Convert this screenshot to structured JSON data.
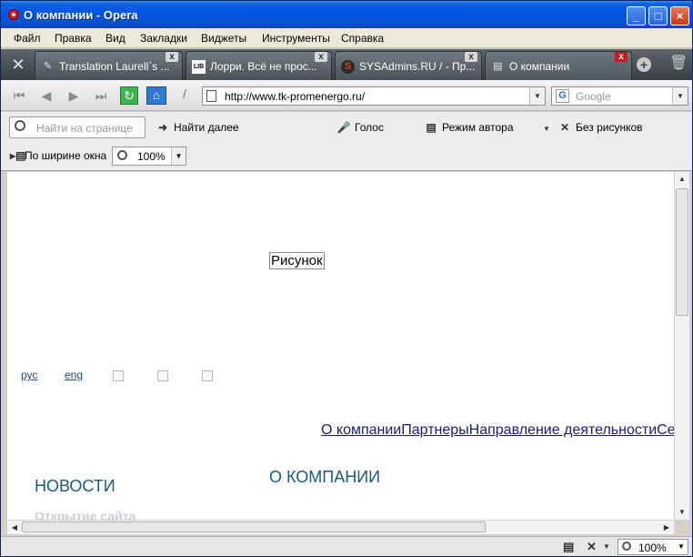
{
  "window": {
    "title": "О компании - Opera"
  },
  "menu": [
    "Файл",
    "Правка",
    "Вид",
    "Закладки",
    "Виджеты",
    "Инструменты",
    "Справка"
  ],
  "tabs": [
    {
      "label": "Translation Laurell`s ...",
      "favicon": "✎"
    },
    {
      "label": "Лорри. Всё не прос...",
      "favicon": "LIB"
    },
    {
      "label": "SYSAdmins.RU / - Пр...",
      "favicon": "S"
    },
    {
      "label": "О компании",
      "favicon": "▤"
    }
  ],
  "address": {
    "url": "http://www.tk-promenergo.ru/"
  },
  "search": {
    "placeholder": "Google",
    "engine_icon": "G"
  },
  "toolbar": {
    "find_placeholder": "Найти на странице",
    "find_next": "Найти далее",
    "voice": "Голос",
    "author_mode": "Режим автора",
    "no_images": "Без рисунков",
    "fit_width": "По ширине окна",
    "zoom": "100%"
  },
  "page": {
    "image_alt": "Рисунок",
    "lang_ru": "рус",
    "lang_en": "eng",
    "nav": [
      "О компании",
      "Партнеры",
      "Направление деятельности",
      "Сер"
    ],
    "news_title": "НОВОСТИ",
    "about_title": "О КОМПАНИИ",
    "news_item": "Открытие сайта"
  },
  "status": {
    "zoom": "100%"
  }
}
